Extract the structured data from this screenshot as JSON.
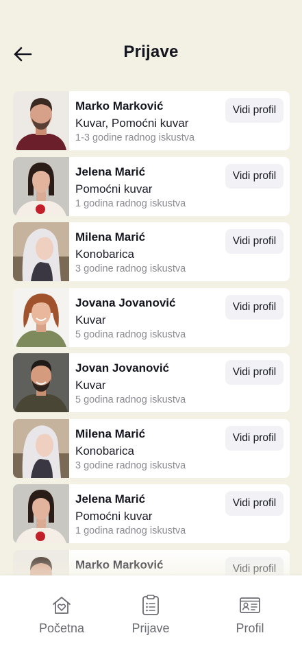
{
  "header": {
    "title": "Prijave",
    "back_icon": "arrow-left-icon"
  },
  "applicants": [
    {
      "name": "Marko Marković",
      "role": "Kuvar, Pomoćni kuvar",
      "experience": "1-3 godine radnog iskustva",
      "button": "Vidi profil",
      "photo": "man-beard-maroon-shirt"
    },
    {
      "name": "Jelena Marić",
      "role": "Pomoćni kuvar",
      "experience": "1 godina radnog iskustva",
      "button": "Vidi profil",
      "photo": "woman-dark-hair-red-flower"
    },
    {
      "name": "Milena Marić",
      "role": "Konobarica",
      "experience": "3 godine radnog iskustva",
      "button": "Vidi profil",
      "photo": "woman-platinum-hair"
    },
    {
      "name": "Jovana Jovanović",
      "role": "Kuvar",
      "experience": "5 godina radnog iskustva",
      "button": "Vidi profil",
      "photo": "woman-auburn-hair-smiling"
    },
    {
      "name": "Jovan Jovanović",
      "role": "Kuvar",
      "experience": "5 godina radnog iskustva",
      "button": "Vidi profil",
      "photo": "man-smiling-beard"
    },
    {
      "name": "Milena Marić",
      "role": "Konobarica",
      "experience": "3 godine radnog iskustva",
      "button": "Vidi profil",
      "photo": "woman-platinum-hair"
    },
    {
      "name": "Jelena Marić",
      "role": "Pomoćni kuvar",
      "experience": "1 godina radnog iskustva",
      "button": "Vidi profil",
      "photo": "woman-dark-hair-red-flower"
    },
    {
      "name": "Marko Marković",
      "role": "",
      "experience": "",
      "button": "Vidi profil",
      "photo": "man-beard-maroon-shirt"
    }
  ],
  "bottom_nav": [
    {
      "label": "Početna",
      "icon": "home-heart-icon"
    },
    {
      "label": "Prijave",
      "icon": "clipboard-list-icon"
    },
    {
      "label": "Profil",
      "icon": "id-card-icon"
    }
  ],
  "colors": {
    "background": "#f3f1e3",
    "card": "#ffffff",
    "button_bg": "#f2f2f6",
    "text_primary": "#14141f",
    "text_muted": "#8b8b93"
  }
}
